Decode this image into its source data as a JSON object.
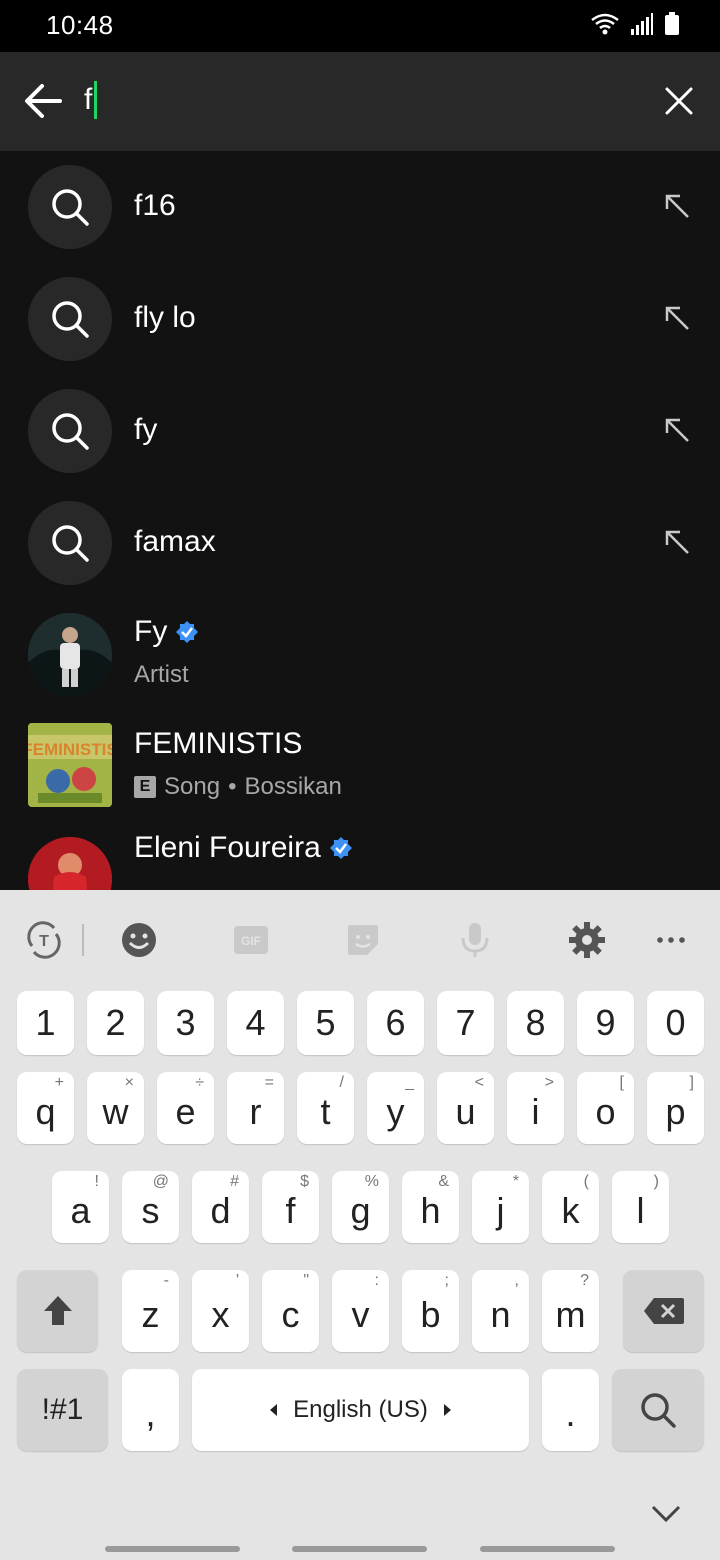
{
  "status": {
    "time": "10:48"
  },
  "search": {
    "query": "f"
  },
  "suggestions": [
    {
      "label": "f16"
    },
    {
      "label": "fly lo"
    },
    {
      "label": "fy"
    },
    {
      "label": "famax"
    }
  ],
  "results": [
    {
      "title": "Fy",
      "subtitle": "Artist",
      "verified": true
    },
    {
      "title": "FEMINISTIS",
      "explicit_badge": "E",
      "type": "Song",
      "separator": "•",
      "artist": "Bossikan",
      "cover_text": "FEMINISTIS"
    },
    {
      "title": "Eleni Foureira",
      "verified": true
    }
  ],
  "keyboard": {
    "number_row": [
      "1",
      "2",
      "3",
      "4",
      "5",
      "6",
      "7",
      "8",
      "9",
      "0"
    ],
    "row1": [
      {
        "k": "q",
        "h": "+"
      },
      {
        "k": "w",
        "h": "×"
      },
      {
        "k": "e",
        "h": "÷"
      },
      {
        "k": "r",
        "h": "="
      },
      {
        "k": "t",
        "h": "/"
      },
      {
        "k": "y",
        "h": "_"
      },
      {
        "k": "u",
        "h": "<"
      },
      {
        "k": "i",
        "h": ">"
      },
      {
        "k": "o",
        "h": "["
      },
      {
        "k": "p",
        "h": "]"
      }
    ],
    "row2": [
      {
        "k": "a",
        "h": "!"
      },
      {
        "k": "s",
        "h": "@"
      },
      {
        "k": "d",
        "h": "#"
      },
      {
        "k": "f",
        "h": "$"
      },
      {
        "k": "g",
        "h": "%"
      },
      {
        "k": "h",
        "h": "&"
      },
      {
        "k": "j",
        "h": "*"
      },
      {
        "k": "k",
        "h": "("
      },
      {
        "k": "l",
        "h": ")"
      }
    ],
    "row3": [
      {
        "k": "z",
        "h": "-"
      },
      {
        "k": "x",
        "h": "'"
      },
      {
        "k": "c",
        "h": "\""
      },
      {
        "k": "v",
        "h": ":"
      },
      {
        "k": "b",
        "h": ";"
      },
      {
        "k": "n",
        "h": ","
      },
      {
        "k": "m",
        "h": "?"
      }
    ],
    "symbols_label": "!#1",
    "comma_label": ",",
    "space_label": "English (US)",
    "period_label": "."
  },
  "colors": {
    "accent": "#1ed760",
    "verified": "#3d91f4",
    "background": "#121212"
  }
}
